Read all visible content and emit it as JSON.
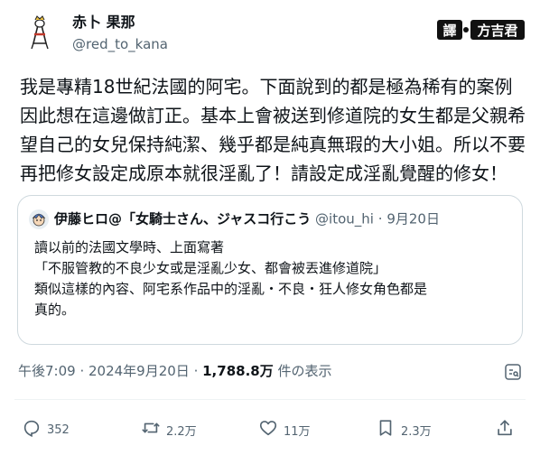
{
  "author": {
    "display_name": "赤卜 果那",
    "handle": "@red_to_kana"
  },
  "watermark": {
    "translator_label": "譯",
    "brand": "方吉君"
  },
  "tweet": {
    "lines": [
      "我是專精18世紀法國的阿宅。下面說到的都是極為稀有的案例",
      "因此想在這邊做訂正。基本上會被送到修道院的女生都是父親希",
      "望自己的女兒保持純潔、幾乎都是純真無瑕的大小姐。所以不要",
      "再把修女設定成原本就很淫亂了！請設定成淫亂覺醒的修女！"
    ]
  },
  "quote": {
    "name": "伊藤ヒロ@「女騎士さん、ジャスコ行こう",
    "handle": "@itou_hi",
    "separator": "·",
    "date": "9月20日",
    "lines": [
      "讀以前的法國文學時、上面寫著",
      "「不服管教的不良少女或是淫亂少女、都會被丟進修道院」",
      "類似這樣的內容、阿宅系作品中的淫亂・不良・狂人修女角色都是",
      "真的。"
    ]
  },
  "meta": {
    "time": "午後7:09",
    "separator1": " · ",
    "date": "2024年9月20日",
    "separator2": " · ",
    "views_count": "1,788.8万",
    "views_label": " 件の表示"
  },
  "actions": {
    "reply_count": "352",
    "retweet_count": "2.2万",
    "like_count": "11万",
    "bookmark_count": "2.3万"
  },
  "colors": {
    "text_primary": "#0f1419",
    "text_secondary": "#536471",
    "border": "#cfd9de"
  }
}
